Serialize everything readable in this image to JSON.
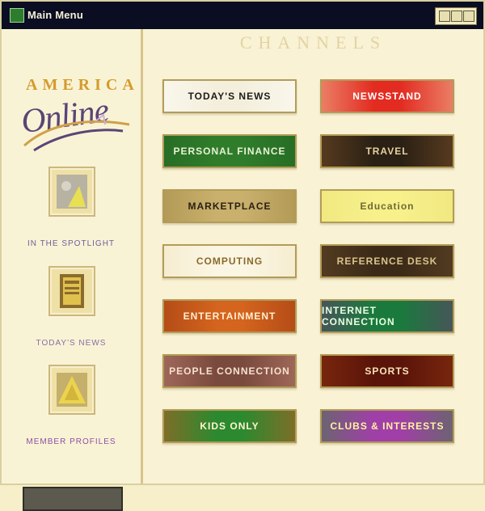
{
  "window": {
    "title": "Main Menu"
  },
  "sidebar": {
    "logo_top": "AMERICA",
    "logo_bottom": "Online",
    "items": [
      {
        "label": "IN THE SPOTLIGHT",
        "label_color": "#6d5e9a",
        "icon": "spotlight-icon"
      },
      {
        "label": "TODAY'S NEWS",
        "label_color": "#8a6fa2",
        "icon": "news-icon"
      },
      {
        "label": "MEMBER PROFILES",
        "label_color": "#8b4fa3",
        "icon": "profiles-icon"
      }
    ]
  },
  "main": {
    "header": "CHANNELS",
    "channels": [
      {
        "label": "TODAY'S NEWS",
        "bg": "#f4efdc",
        "fg": "#1b1b1b",
        "accent": "#ffffff"
      },
      {
        "label": "NEWSSTAND",
        "bg": "#e32b21",
        "fg": "#ffffff",
        "accent": "#f2e3b7"
      },
      {
        "label": "PERSONAL FINANCE",
        "bg": "#2f7d2b",
        "fg": "#e9f2d4",
        "accent": "#1d5a1f"
      },
      {
        "label": "TRAVEL",
        "bg": "#2a2014",
        "fg": "#e6d2a0",
        "accent": "#8c5a2b"
      },
      {
        "label": "MARKETPLACE",
        "bg": "#c9b06d",
        "fg": "#2a2114",
        "accent": "#9a7f3b"
      },
      {
        "label": "Education",
        "bg": "#f7f08b",
        "fg": "#6f6a33",
        "accent": "#eadf74"
      },
      {
        "label": "COMPUTING",
        "bg": "#fbf6e4",
        "fg": "#8a6a2a",
        "accent": "#f0e2b8"
      },
      {
        "label": "REFERENCE DESK",
        "bg": "#3c2a18",
        "fg": "#d9c48a",
        "accent": "#6c4f2b"
      },
      {
        "label": "ENTERTAINMENT",
        "bg": "#d4641e",
        "fg": "#fff0d2",
        "accent": "#8f3010"
      },
      {
        "label": "INTERNET CONNECTION",
        "bg": "#1a7a3d",
        "fg": "#e9ffe3",
        "accent": "#7b2a7a"
      },
      {
        "label": "PEOPLE CONNECTION",
        "bg": "#7a4a3e",
        "fg": "#f6e0cf",
        "accent": "#c98a78"
      },
      {
        "label": "SPORTS",
        "bg": "#5a1409",
        "fg": "#f8e2b9",
        "accent": "#9b3b13"
      },
      {
        "label": "KIDS ONLY",
        "bg": "#2b8a2f",
        "fg": "#fff4d2",
        "accent": "#e24b1f"
      },
      {
        "label": "CLUBS & INTERESTS",
        "bg": "#a13fa8",
        "fg": "#fff2a3",
        "accent": "#2c8f2f"
      }
    ]
  }
}
